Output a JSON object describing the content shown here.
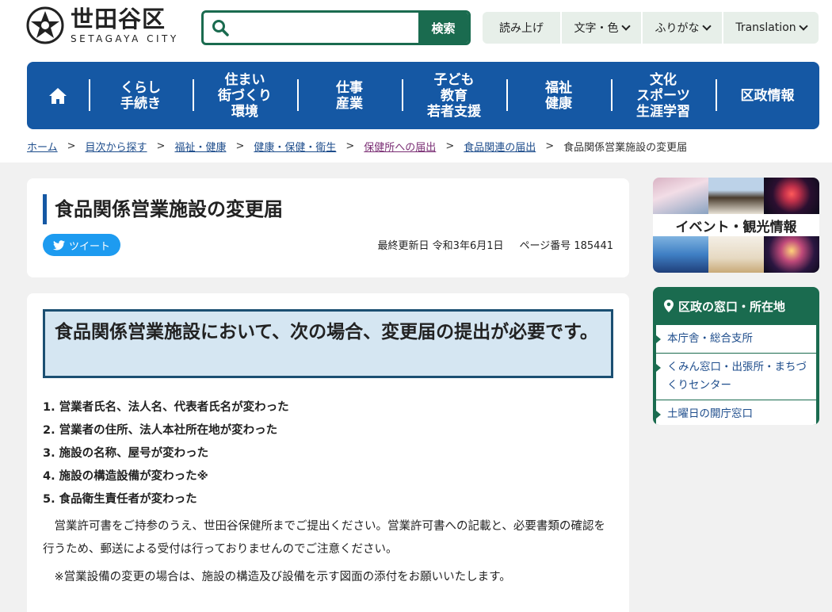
{
  "site": {
    "name_jp": "世田谷区",
    "name_en": "SETAGAYA CITY"
  },
  "search": {
    "placeholder": "",
    "button_label": "検索"
  },
  "tools": [
    {
      "label": "読み上げ",
      "has_dropdown": false
    },
    {
      "label": "文字・色",
      "has_dropdown": true
    },
    {
      "label": "ふりがな",
      "has_dropdown": true
    },
    {
      "label": "Translation",
      "has_dropdown": true
    }
  ],
  "nav": {
    "home_icon": "home-icon",
    "items": [
      {
        "label": "くらし\n手続き"
      },
      {
        "label": "住まい\n街づくり\n環境"
      },
      {
        "label": "仕事\n産業"
      },
      {
        "label": "子ども\n教育\n若者支援"
      },
      {
        "label": "福祉\n健康"
      },
      {
        "label": "文化\nスポーツ\n生涯学習"
      },
      {
        "label": "区政情報"
      }
    ]
  },
  "breadcrumb": {
    "items": [
      {
        "label": "ホーム",
        "visited": false
      },
      {
        "label": "目次から探す",
        "visited": false
      },
      {
        "label": "福祉・健康",
        "visited": false
      },
      {
        "label": "健康・保健・衛生",
        "visited": false
      },
      {
        "label": "保健所への届出",
        "visited": true
      },
      {
        "label": "食品関連の届出",
        "visited": false
      }
    ],
    "current": "食品関係営業施設の変更届",
    "separator": ">"
  },
  "page": {
    "title": "食品関係営業施設の変更届",
    "tweet_label": "ツイート",
    "updated": "最終更新日 令和3年6月1日",
    "page_number": "ページ番号 185441"
  },
  "content": {
    "heading": "食品関係営業施設において、次の場合、変更届の提出が必要です。",
    "list": [
      "1. 営業者氏名、法人名、代表者氏名が変わった",
      "2. 営業者の住所、法人本社所在地が変わった",
      "3. 施設の名称、屋号が変わった",
      "4. 施設の構造設備が変わった※",
      "5. 食品衛生責任者が変わった"
    ],
    "paragraph1": "営業許可書をご持参のうえ、世田谷保健所までご提出ください。営業許可書への記載と、必要書類の確認を行うため、郵送による受付は行っておりませんのでご注意ください。",
    "paragraph2": "※営業設備の変更の場合は、施設の構造及び設備を示す図面の添付をお願いいたします。"
  },
  "sidebar": {
    "banner_text": "イベント・観光情報",
    "office": {
      "title": "区政の窓口・所在地",
      "items": [
        "本庁舎・総合支所",
        "くみん窓口・出張所・まちづくりセンター",
        "土曜日の開庁窓口"
      ]
    }
  },
  "colors": {
    "nav_blue": "#1558a4",
    "brand_green": "#1a6b4f",
    "heading_box_bg": "#d5e6f2",
    "link": "#1e4d8c",
    "tweet_blue": "#1d9bf0"
  }
}
